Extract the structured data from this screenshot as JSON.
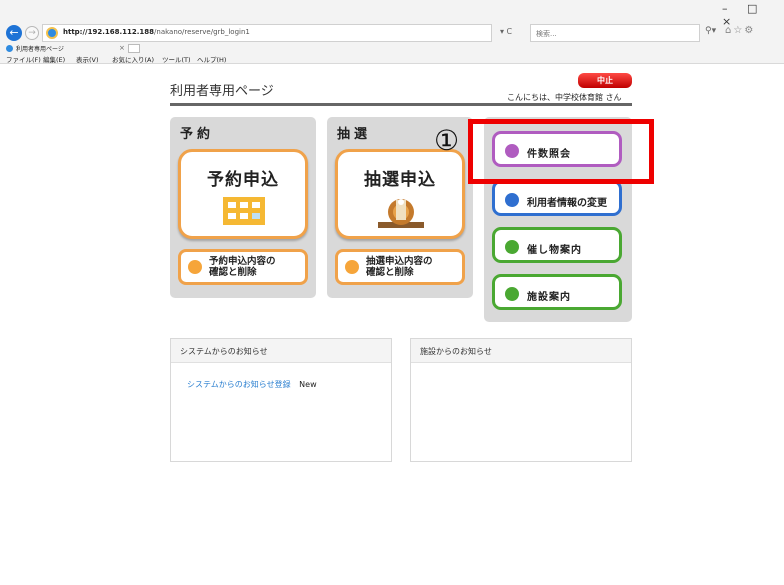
{
  "browser": {
    "url_host": "http://192.168.112.188",
    "url_path": "/nakano/reserve/grb_login1",
    "addr_tools": "▾ C",
    "search_placeholder": "検索...",
    "tab_title": "利用者専用ページ",
    "tab_close": "×",
    "window_controls": "– □ ×",
    "toolbar_icons": "⌂☆⚙",
    "menu": [
      "ファイル(F)",
      "編集(E)",
      "表示(V)",
      "お気に入り(A)",
      "ツール(T)",
      "ヘルプ(H)"
    ]
  },
  "header": {
    "title": "利用者専用ページ",
    "greeting": "こんにちは、中学校体育館 さん",
    "stop_label": "中止"
  },
  "reserve": {
    "label": "予約",
    "main_button": "予約申込",
    "confirm_line1": "予約申込内容の",
    "confirm_line2": "確認と削除"
  },
  "lottery": {
    "label": "抽選",
    "main_button": "抽選申込",
    "confirm_line1": "抽選申込内容の",
    "confirm_line2": "確認と削除"
  },
  "side_menu": {
    "items": [
      {
        "label": "件数照会",
        "color": "#b05cc0"
      },
      {
        "label": "利用者情報の変更",
        "color": "#2f6fd0"
      },
      {
        "label": "催し物案内",
        "color": "#4aa832"
      },
      {
        "label": "施設案内",
        "color": "#4aa832"
      }
    ]
  },
  "annotation": {
    "marker": "①"
  },
  "notices": {
    "system_title": "システムからのお知らせ",
    "system_link": "システムからのお知らせ登録",
    "system_badge": "New",
    "facility_title": "施設からのお知らせ"
  }
}
